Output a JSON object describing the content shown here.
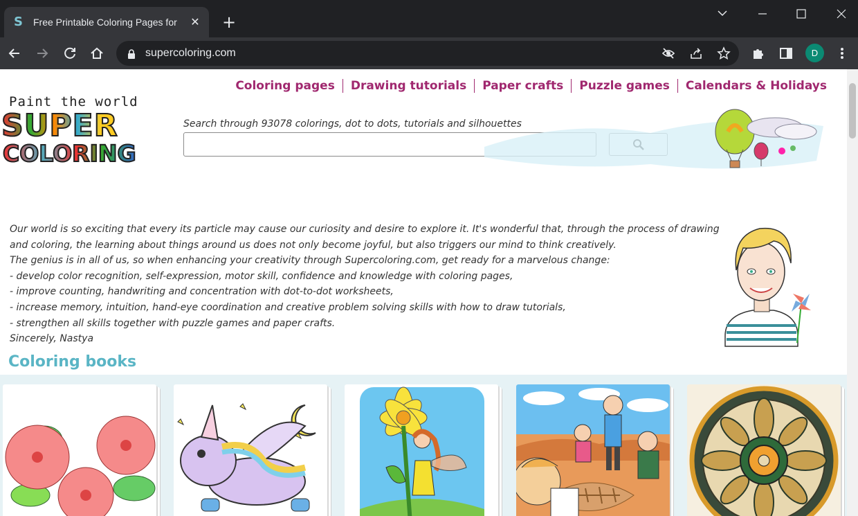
{
  "browser": {
    "tab_title": "Free Printable Coloring Pages for",
    "tab_favicon": "S",
    "tab_close": "✕",
    "new_tab": "+",
    "url": "supercoloring.com",
    "avatar_initial": "D",
    "icons": [
      "back-icon",
      "forward-icon",
      "reload-icon",
      "home-icon",
      "lock-icon",
      "eye-off-icon",
      "share-icon",
      "star-icon",
      "puzzle-icon",
      "side-panel-icon",
      "menu-icon"
    ]
  },
  "site": {
    "nav": [
      "Coloring pages",
      "Drawing tutorials",
      "Paper crafts",
      "Puzzle games",
      "Calendars & Holidays"
    ],
    "logo": {
      "tagline": "Paint the world",
      "word1": "SUPER",
      "word2": "COLORING"
    },
    "search": {
      "caption": "Search through 93078 colorings, dot to dots, tutorials and silhouettes",
      "value": ""
    },
    "intro": [
      "Our world is so exciting that every its particle may cause our curiosity and desire to explore it. It's wonderful that, through the process of drawing",
      "and coloring, the learning about things around us does not only become joyful, but also triggers our mind to think creatively.",
      "The genius is in all of us, so when enhancing your creativity through Supercoloring.com, get ready for a marvelous change:",
      "- develop color recognition, self-expression, motor skill, confidence and knowledge with coloring pages,",
      "- improve counting, handwriting and concentration with dot-to-dot worksheets,",
      "- increase memory, intuition, hand-eye coordination and creative problem solving skills with how to draw tutorials,",
      "- strengthen all skills together with puzzle games and paper crafts.",
      "Sincerely, Nastya"
    ],
    "section_title": "Coloring books",
    "books": [
      "hibiscus-flowers",
      "flying-unicorn",
      "flower-fairy",
      "dinosaur-dig",
      "mandala"
    ],
    "colors": {
      "nav": "#a0286f",
      "section": "#5ab5c5",
      "strip": "#e6f2f5"
    }
  }
}
